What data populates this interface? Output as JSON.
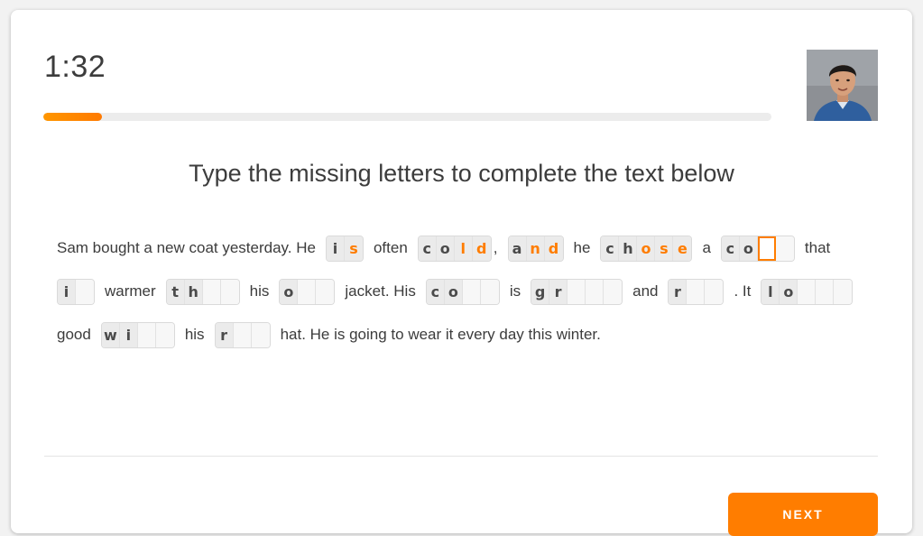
{
  "timer": "1:32",
  "progress": 0.08,
  "heading": "Type the missing letters to complete the text below",
  "next_label": "NEXT",
  "colors": {
    "accent": "#ff7d00",
    "text": "#3c3c3c"
  },
  "video": {
    "icon": "proctor-video"
  },
  "passage": {
    "lines": [
      [
        {
          "t": "text",
          "v": "Sam bought a new coat yesterday. He"
        },
        {
          "t": "boxes",
          "given": "i",
          "typed": "s",
          "slots": 2
        },
        {
          "t": "text",
          "v": "often"
        },
        {
          "t": "boxes",
          "given": "co",
          "typed": "ld",
          "slots": 4
        },
        {
          "t": "punct",
          "v": ","
        },
        {
          "t": "boxes",
          "given": "a",
          "typed": "nd",
          "slots": 3
        },
        {
          "t": "text",
          "v": "he"
        },
        {
          "t": "boxes",
          "given": "ch",
          "typed": "ose",
          "slots": 5
        },
        {
          "t": "text",
          "v": "a"
        },
        {
          "t": "boxes",
          "given": "co",
          "typed": "",
          "slots": 4,
          "active": 2
        },
        {
          "t": "text",
          "v": "that"
        }
      ],
      [
        {
          "t": "boxes",
          "given": "i",
          "typed": "",
          "slots": 2
        },
        {
          "t": "text",
          "v": "warmer"
        },
        {
          "t": "boxes",
          "given": "th",
          "typed": "",
          "slots": 4
        },
        {
          "t": "text",
          "v": "his"
        },
        {
          "t": "boxes",
          "given": "o",
          "typed": "",
          "slots": 3
        },
        {
          "t": "text",
          "v": "jacket.  His"
        },
        {
          "t": "boxes",
          "given": "co",
          "typed": "",
          "slots": 4
        },
        {
          "t": "text",
          "v": "is"
        },
        {
          "t": "boxes",
          "given": "gr",
          "typed": "",
          "slots": 5
        },
        {
          "t": "text",
          "v": "and"
        },
        {
          "t": "boxes",
          "given": "r",
          "typed": "",
          "slots": 3
        },
        {
          "t": "text",
          "v": ". It"
        },
        {
          "t": "boxes",
          "given": "lo",
          "typed": "",
          "slots": 5
        }
      ],
      [
        {
          "t": "text",
          "v": "good"
        },
        {
          "t": "boxes",
          "given": "wi",
          "typed": "",
          "slots": 4
        },
        {
          "t": "text",
          "v": "his"
        },
        {
          "t": "boxes",
          "given": "r",
          "typed": "",
          "slots": 3
        },
        {
          "t": "text",
          "v": "hat. He is going to wear it every day this winter."
        }
      ]
    ]
  }
}
